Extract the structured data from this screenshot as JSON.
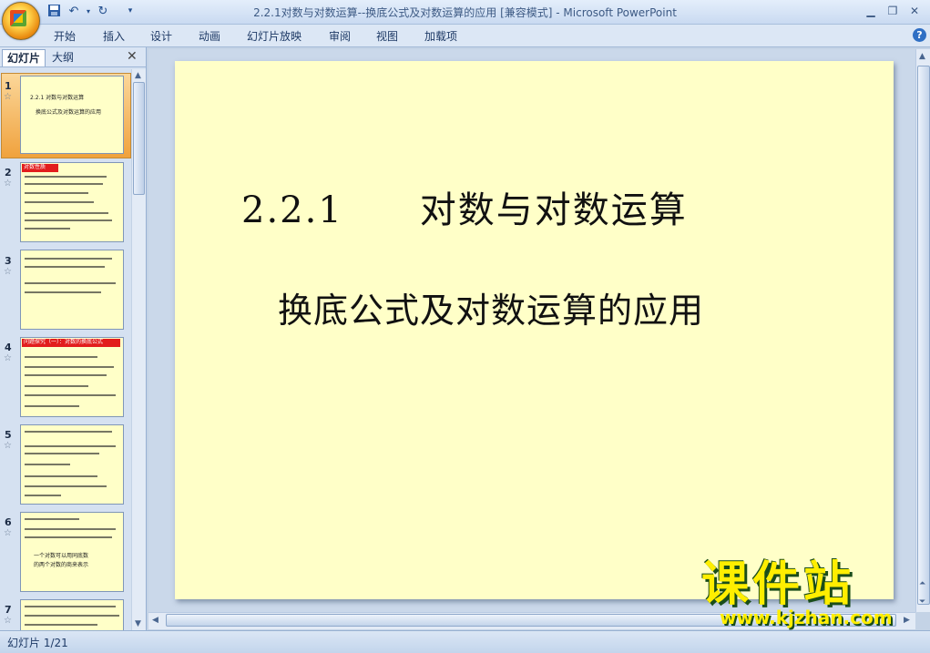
{
  "window": {
    "title": "2.2.1对数与对数运算--换底公式及对数运算的应用 [兼容模式] - Microsoft PowerPoint",
    "controls": [
      "minimize",
      "maximize",
      "close"
    ]
  },
  "quick_access": [
    {
      "icon": "save-icon"
    },
    {
      "icon": "undo-icon"
    },
    {
      "icon": "redo-icon"
    },
    {
      "icon": "customize-icon"
    }
  ],
  "ribbon": {
    "tabs": [
      "开始",
      "插入",
      "设计",
      "动画",
      "幻灯片放映",
      "审阅",
      "视图",
      "加载项"
    ],
    "help_label": "?"
  },
  "panel": {
    "tab_slides": "幻灯片",
    "tab_outline": "大纲",
    "close_label": "✕",
    "thumbnails": [
      {
        "number": "1",
        "selected": true
      },
      {
        "number": "2",
        "header": "对数性质"
      },
      {
        "number": "3"
      },
      {
        "number": "4",
        "header": "问题探究（一）：对数的换底公式"
      },
      {
        "number": "5"
      },
      {
        "number": "6"
      },
      {
        "number": "7"
      }
    ],
    "thumbnail_text": {
      "s1_line1": "2.2.1   对数与对数运算",
      "s1_line2": "换底公式及对数运算的应用",
      "s6_line1": "一个对数可以用同底数",
      "s6_line2": "的两个对数的商来表示"
    }
  },
  "slide": {
    "title": "2.2.1　　对数与对数运算",
    "subtitle": "换底公式及对数运算的应用",
    "background": "#ffffc8"
  },
  "status": {
    "slide_indicator": "幻灯片 1/21"
  },
  "watermark": {
    "text": "课件站",
    "url": "www.kjzhan.com"
  },
  "colors": {
    "selected_thumb": "#f0a23d",
    "slide_bg": "#ffffc8",
    "thumb_header_red": "#e21d1d"
  }
}
